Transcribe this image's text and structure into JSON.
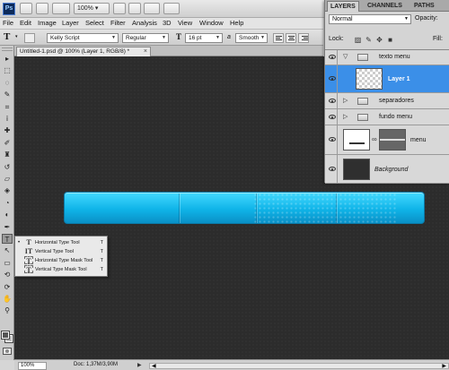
{
  "app": {
    "logo": "Ps",
    "zoom": "100%"
  },
  "menu": [
    "File",
    "Edit",
    "Image",
    "Layer",
    "Select",
    "Filter",
    "Analysis",
    "3D",
    "View",
    "Window",
    "Help"
  ],
  "options": {
    "tool_icon": "T",
    "font_family": "Kelly Script",
    "font_style": "Regular",
    "size_icon": "T",
    "font_size": "16 pt",
    "aa_prefix": "a",
    "aa": "Smooth"
  },
  "document": {
    "tab_label": "Untitled-1.psd @ 100% (Layer 1, RGB/8) *",
    "close": "×"
  },
  "tools": [
    {
      "name": "move-tool-icon",
      "glyph": "▸"
    },
    {
      "name": "marquee-tool-icon",
      "glyph": "⬚"
    },
    {
      "name": "lasso-tool-icon",
      "glyph": "◌"
    },
    {
      "name": "quick-select-tool-icon",
      "glyph": "✎"
    },
    {
      "name": "crop-tool-icon",
      "glyph": "⌗"
    },
    {
      "name": "eyedropper-tool-icon",
      "glyph": "ⅰ"
    },
    {
      "name": "healing-brush-tool-icon",
      "glyph": "✚"
    },
    {
      "name": "brush-tool-icon",
      "glyph": "✐"
    },
    {
      "name": "clone-stamp-tool-icon",
      "glyph": "♜"
    },
    {
      "name": "history-brush-tool-icon",
      "glyph": "↺"
    },
    {
      "name": "eraser-tool-icon",
      "glyph": "▱"
    },
    {
      "name": "paint-bucket-tool-icon",
      "glyph": "◈"
    },
    {
      "name": "blur-tool-icon",
      "glyph": "◔"
    },
    {
      "name": "dodge-tool-icon",
      "glyph": "◐"
    },
    {
      "name": "pen-tool-icon",
      "glyph": "✒"
    },
    {
      "name": "type-tool-icon",
      "glyph": "T"
    },
    {
      "name": "path-selection-tool-icon",
      "glyph": "↖"
    },
    {
      "name": "shape-tool-icon",
      "glyph": "▭"
    },
    {
      "name": "3d-rotate-tool-icon",
      "glyph": "⟲"
    },
    {
      "name": "3d-orbit-tool-icon",
      "glyph": "⟳"
    },
    {
      "name": "hand-tool-icon",
      "glyph": "✋"
    },
    {
      "name": "zoom-tool-icon",
      "glyph": "⚲"
    }
  ],
  "flyout": {
    "bullet": "•",
    "items": [
      {
        "icon": "T",
        "label": "Horizontal Type Tool",
        "key": "T"
      },
      {
        "icon": "IT",
        "label": "Vertical Type Tool",
        "key": "T"
      },
      {
        "icon": "T",
        "label": "Horizontal Type Mask Tool",
        "key": "T"
      },
      {
        "icon": "T",
        "label": "Vertical Type Mask Tool",
        "key": "T"
      }
    ]
  },
  "status": {
    "zoom": "100%",
    "doc": "Doc: 1,37M/3,90M",
    "arrow": "▶",
    "scroll_left": "◀",
    "scroll_right": "▶"
  },
  "layers_panel": {
    "tabs": [
      "LAYERS",
      "CHANNELS",
      "PATHS"
    ],
    "blend_mode": "Normal",
    "opacity_label": "Opacity:",
    "lock_label": "Lock:",
    "fill_label": "Fill:",
    "layers": [
      {
        "name": "texto menu",
        "type": "group",
        "expanded": true
      },
      {
        "name": "Layer 1",
        "type": "layer",
        "selected": true
      },
      {
        "name": "separadores",
        "type": "group",
        "expanded": false
      },
      {
        "name": "fundo menu",
        "type": "group",
        "expanded": false
      },
      {
        "name": "menu",
        "type": "masked-layer"
      },
      {
        "name": "Background",
        "type": "background"
      }
    ],
    "expand_glyph": "▽",
    "collapse_glyph": "▷",
    "chain_glyph": "🔗"
  },
  "colors": {
    "canvas": "#2c2c2c",
    "menu_graphic": "#1ab8ec",
    "selection": "#3b8fe8"
  }
}
